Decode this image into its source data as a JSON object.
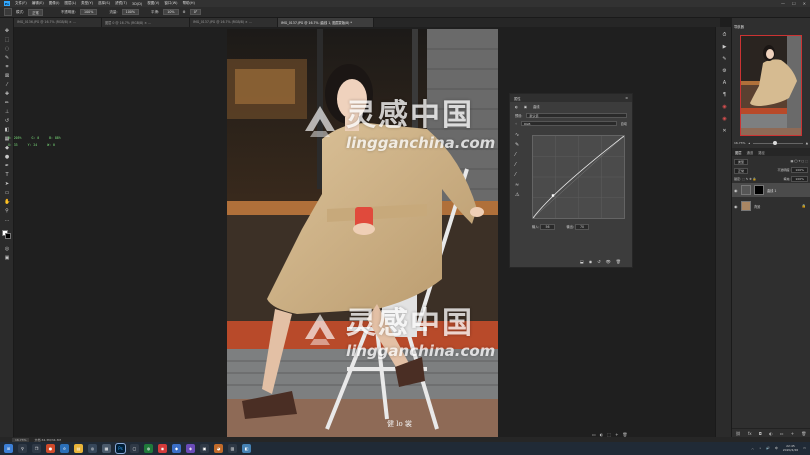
{
  "app": {
    "logo_text": "Ps",
    "menus": [
      "文件(F)",
      "编辑(E)",
      "图像(I)",
      "图层(L)",
      "类型(Y)",
      "选择(S)",
      "滤镜(T)",
      "3D(D)",
      "视图(V)",
      "窗口(W)",
      "帮助(H)"
    ],
    "window_controls": [
      "—",
      "☐",
      "✕"
    ]
  },
  "options_bar": {
    "mode_label": "模式:",
    "mode_value": "正常",
    "opacity_label": "不透明度:",
    "opacity_value": "100%",
    "flow_label": "流量:",
    "flow_value": "100%",
    "smooth_label": "平滑:",
    "smooth_value": "10%",
    "angle_value": "0°"
  },
  "tabs": [
    {
      "label": "IMG_0136.JPG @ 16.7% (RGB/8) × ...",
      "active": false
    },
    {
      "label": "图层 0 @ 16.7% (RGB/8) × ...",
      "active": false
    },
    {
      "label": "IMG_0137.JPG @ 16.7% (RGB/8) × ...",
      "active": false
    },
    {
      "label": "IMG_0137.JPG @ 16.7% (曲线 1, 图层蒙版/8) *",
      "active": true
    },
    {
      "label": "",
      "active": false
    },
    {
      "label": "",
      "active": false
    },
    {
      "label": "",
      "active": false
    }
  ],
  "info_overlay": {
    "row1": [
      "R: 205%",
      "G: 0",
      "B: 88%"
    ],
    "row2": [
      "X: 33",
      "Y: 24",
      "W: 0"
    ]
  },
  "curves": {
    "panel_title": "属性",
    "sub_title": "曲线",
    "preset_label": "预设:",
    "preset_value": "默认值",
    "channel_value": "RGB",
    "auto_label": "自动",
    "input_label": "输入:",
    "input_value": "56",
    "output_label": "输出:",
    "output_value": "70",
    "curve_points": [
      [
        0,
        0
      ],
      [
        56,
        70
      ],
      [
        255,
        255
      ]
    ]
  },
  "navigator": {
    "title": "导航器",
    "zoom_value": "16.73%"
  },
  "layers": {
    "tabs": [
      "图层",
      "通道",
      "路径"
    ],
    "kind_label": "类型",
    "blend_value": "正常",
    "opacity_label": "不透明度:",
    "opacity_value": "100%",
    "lock_label": "锁定:",
    "fill_label": "填充:",
    "fill_value": "100%",
    "rows": [
      {
        "name": "曲线 1",
        "selected": true
      },
      {
        "name": "背景",
        "selected": false
      }
    ]
  },
  "status": {
    "zoom": "16.73%",
    "doc_info": "文档:34.3M/34.3M"
  },
  "taskbar": {
    "time": "22:45",
    "date": "2020/4/26",
    "lang": "中"
  },
  "watermark": {
    "cn": "灵感中国",
    "en": "lingganchina.com"
  },
  "photo_caption": "健 lo 裳",
  "colors": {
    "ps_blue": "#31a8ff",
    "panel_bg": "#3c3c3c",
    "info_green": "#7de37d",
    "nav_frame": "#cc3333"
  }
}
